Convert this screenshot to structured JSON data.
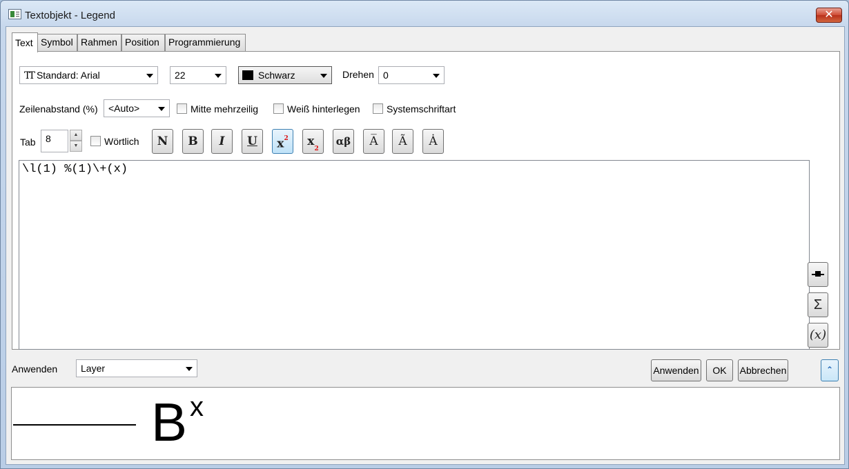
{
  "window": {
    "title": "Textobjekt - Legend",
    "close_label": "✕"
  },
  "tabs": [
    {
      "label": "Text",
      "active": true
    },
    {
      "label": "Symbol"
    },
    {
      "label": "Rahmen"
    },
    {
      "label": "Position"
    },
    {
      "label": "Programmierung"
    }
  ],
  "font": {
    "value": "Standard: Arial",
    "icon": "font-type-icon"
  },
  "size": {
    "value": "22"
  },
  "color": {
    "value": "Schwarz",
    "swatch": "#000000"
  },
  "rotate": {
    "label": "Drehen",
    "value": "0"
  },
  "line_spacing": {
    "label": "Zeilenabstand (%)",
    "value": "<Auto>"
  },
  "checkboxes": {
    "center_multiline": "Mitte mehrzeilig",
    "white_background": "Weiß hinterlegen",
    "system_font": "Systemschriftart",
    "literal": "Wörtlich"
  },
  "tab_stop": {
    "label": "Tab",
    "value": "8"
  },
  "format_buttons": {
    "normal": "N",
    "bold": "B",
    "italic": "I",
    "underline": "U",
    "superscript": "x",
    "superscript_mark": "2",
    "subscript": "x",
    "subscript_mark": "2",
    "greek": "αβ",
    "overbar": "A̅",
    "tilde": "Ã",
    "dot": "Ȧ"
  },
  "editor": {
    "text": "\\l(1) %(1)\\+(x)"
  },
  "side_buttons": {
    "sigma": "Σ",
    "var": "(x)"
  },
  "apply": {
    "label": "Anwenden",
    "target": "Layer"
  },
  "actions": {
    "apply": "Anwenden",
    "ok": "OK",
    "cancel": "Abbrechen"
  },
  "preview": {
    "text": "B",
    "sup": "x"
  }
}
